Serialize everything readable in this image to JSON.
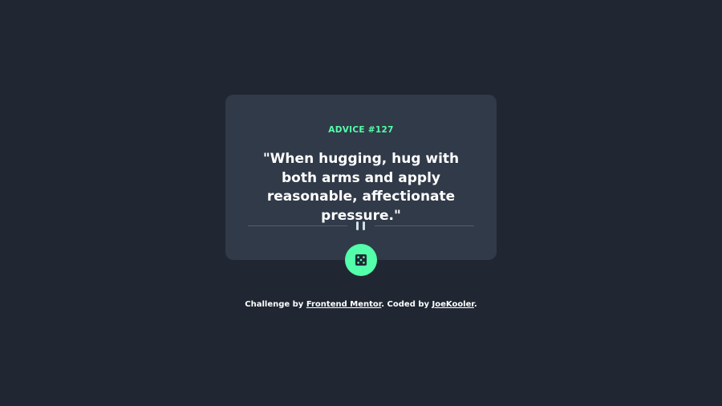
{
  "card": {
    "label_prefix": "ADVICE #",
    "advice_number": "127",
    "quote": "\"When hugging, hug with both arms and apply reasonable, affectionate pressure.\""
  },
  "dice_button": {
    "icon": "dice-icon"
  },
  "attribution": {
    "challenge_text": "Challenge by",
    "challenge_link": "Frontend Mentor",
    "coded_text": ". Coded by",
    "author_link": "JoeKooler",
    "end_text": "."
  },
  "colors": {
    "background": "#202733",
    "card": "#313a48",
    "accent": "#53ffaa",
    "divider": "#4f5d74",
    "text": "#ffffff"
  }
}
